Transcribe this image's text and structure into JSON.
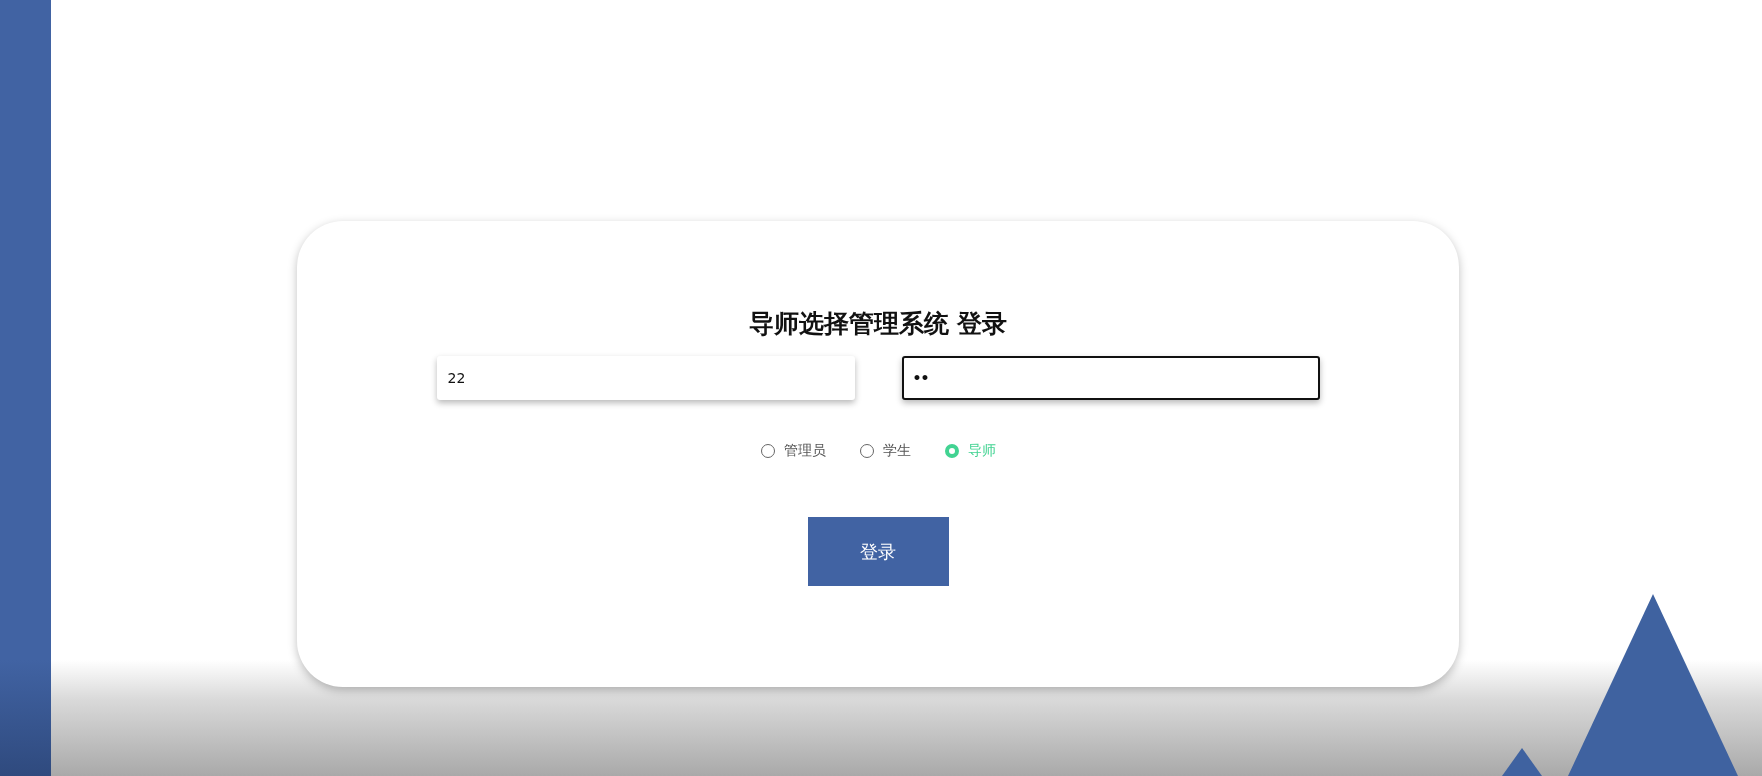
{
  "title": "导师选择管理系统 登录",
  "fields": [
    {
      "kind": "username",
      "value": "22",
      "focused": false
    },
    {
      "kind": "password",
      "value": "••",
      "focused": true
    }
  ],
  "roles": [
    {
      "label": "管理员",
      "selected": false
    },
    {
      "label": "学生",
      "selected": false
    },
    {
      "label": "导师",
      "selected": true
    }
  ],
  "login_button": "登录"
}
